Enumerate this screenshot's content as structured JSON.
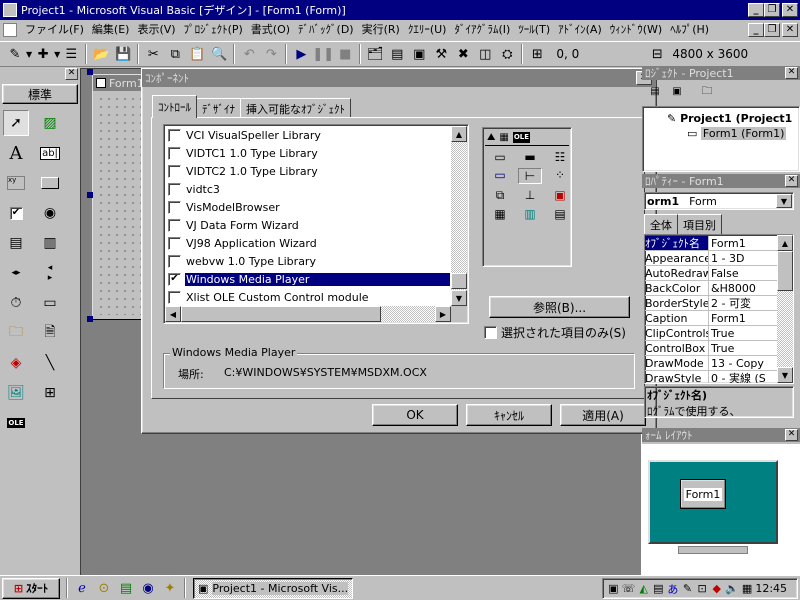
{
  "window": {
    "title": "Project1 - Microsoft Visual Basic [デザイン] - [Form1 (Form)]"
  },
  "menu": [
    "ファイル(F)",
    "編集(E)",
    "表示(V)",
    "ﾌﾟﾛｼﾞｪｸﾄ(P)",
    "書式(O)",
    "ﾃﾞﾊﾞｯｸﾞ(D)",
    "実行(R)",
    "ｸｴﾘｰ(U)",
    "ﾀﾞｲｱｸﾞﾗﾑ(I)",
    "ﾂｰﾙ(T)",
    "ｱﾄﾞｲﾝ(A)",
    "ｳｨﾝﾄﾞｳ(W)",
    "ﾍﾙﾌﾟ(H)"
  ],
  "toolbar": {
    "position": "0, 0",
    "size": "4800 x 3600"
  },
  "toolbox": {
    "tab_label": "標準"
  },
  "form": {
    "title": "Form1"
  },
  "dialog": {
    "title": "ｺﾝﾎﾟｰﾈﾝﾄ",
    "tabs": [
      "ｺﾝﾄﾛｰﾙ",
      "ﾃﾞｻﾞｲﾅ",
      "挿入可能なｵﾌﾞｼﾞｪｸﾄ"
    ],
    "items": [
      {
        "label": "VCI VisualSpeller Library",
        "checked": false
      },
      {
        "label": "VIDTC1 1.0 Type Library",
        "checked": false
      },
      {
        "label": "VIDTC2 1.0 Type Library",
        "checked": false
      },
      {
        "label": "vidtc3",
        "checked": false
      },
      {
        "label": "VisModelBrowser",
        "checked": false
      },
      {
        "label": "VJ Data Form Wizard",
        "checked": false
      },
      {
        "label": "VJ98 Application Wizard",
        "checked": false
      },
      {
        "label": "webvw 1.0 Type Library",
        "checked": false
      },
      {
        "label": "Windows Media Player",
        "checked": true
      },
      {
        "label": "Xlist OLE Custom Control module",
        "checked": false
      }
    ],
    "browse_button": "参照(B)...",
    "selected_only_label": "選択された項目のみ(S)",
    "group_title": "Windows Media Player",
    "location_label": "場所:",
    "location_value": "C:¥WINDOWS¥SYSTEM¥MSDXM.OCX",
    "ok": "OK",
    "cancel": "ｷｬﾝｾﾙ",
    "apply": "適用(A)"
  },
  "project": {
    "title": "ﾛｼﾞｪｸﾄ - Project1",
    "root": "Project1 (Project1",
    "child": "Form1 (Form1)"
  },
  "properties": {
    "title": "ﾛﾊﾟﾃｨｰ - Form1",
    "object": "orm1",
    "object_type": "Form",
    "tabs": [
      "全体",
      "項目別"
    ],
    "rows": [
      {
        "name": "ｵﾌﾞｼﾞｪｸﾄ名",
        "value": "Form1"
      },
      {
        "name": "Appearance",
        "value": "1 - 3D"
      },
      {
        "name": "AutoRedraw",
        "value": "False"
      },
      {
        "name": "BackColor",
        "value": "&H8000"
      },
      {
        "name": "BorderStyle",
        "value": "2 - 可変"
      },
      {
        "name": "Caption",
        "value": "Form1"
      },
      {
        "name": "ClipControls",
        "value": "True"
      },
      {
        "name": "ControlBox",
        "value": "True"
      },
      {
        "name": "DrawMode",
        "value": "13 - Copy"
      },
      {
        "name": "DrawStyle",
        "value": "0 - 実線 (S"
      }
    ],
    "desc_title": "ｵﾌﾞｼﾞｪｸﾄ名)",
    "desc_text": "ﾛｸﾞﾗﾑで使用する、"
  },
  "layout_window": {
    "title": "ｫｰﾑ ﾚｲｱｳﾄ",
    "form_label": "Form1"
  },
  "taskbar": {
    "start": "ｽﾀｰﾄ",
    "task": "Project1 - Microsoft Vis...",
    "clock": "12:45"
  }
}
